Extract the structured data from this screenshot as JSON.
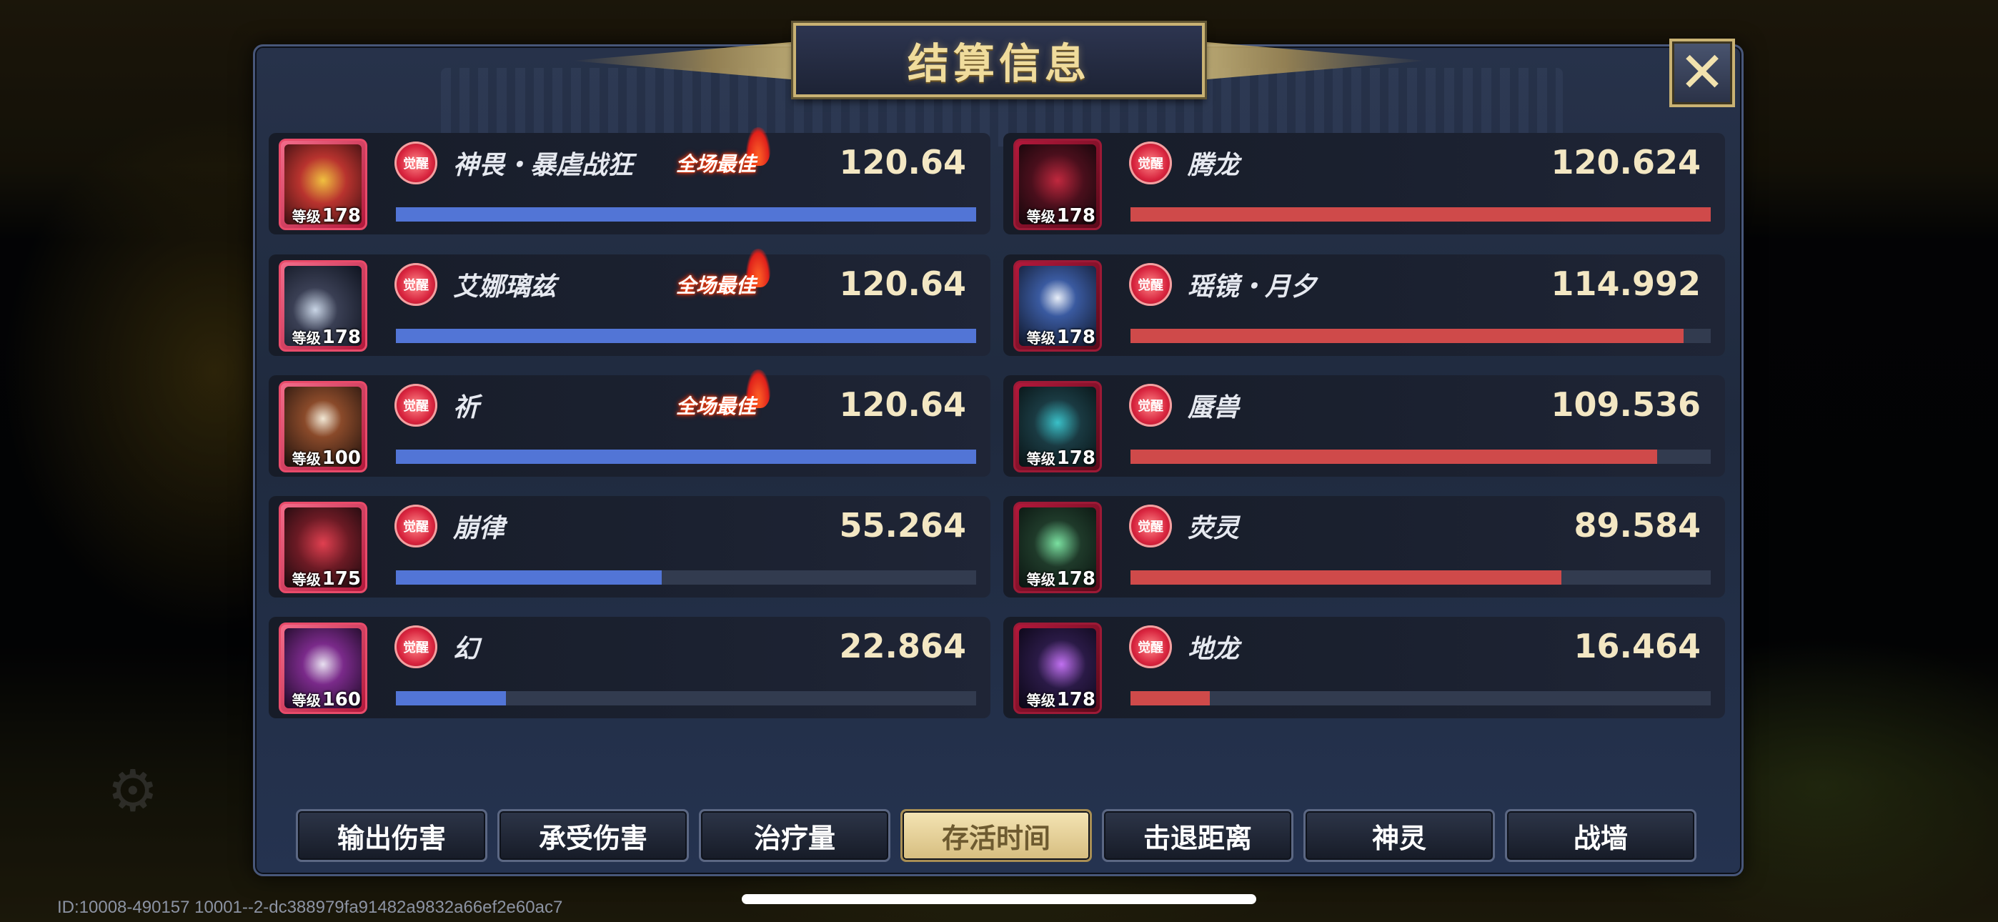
{
  "title": "结算信息",
  "mvp_label": "全场最佳",
  "level_label": "等级",
  "awake_label": "觉醒",
  "left_team": [
    {
      "name": "神畏・暴虐战狂",
      "level": "178",
      "value": "120.64",
      "mvp": true,
      "fill": 1.0,
      "avatar_color": "#b8332e"
    },
    {
      "name": "艾娜璃兹",
      "level": "178",
      "value": "120.64",
      "mvp": true,
      "fill": 1.0,
      "avatar_color": "#3a3f54"
    },
    {
      "name": "祈",
      "level": "100",
      "value": "120.64",
      "mvp": true,
      "fill": 1.0,
      "avatar_color": "#2c1f1a"
    },
    {
      "name": "崩律",
      "level": "175",
      "value": "55.264",
      "mvp": false,
      "fill": 0.458,
      "avatar_color": "#6b1a24"
    },
    {
      "name": "幻",
      "level": "160",
      "value": "22.864",
      "mvp": false,
      "fill": 0.19,
      "avatar_color": "#3c1d4a"
    }
  ],
  "right_team": [
    {
      "name": "腾龙",
      "level": "178",
      "value": "120.624",
      "fill": 1.0,
      "avatar_color": "#4a0f1c"
    },
    {
      "name": "瑶镜・月夕",
      "level": "178",
      "value": "114.992",
      "fill": 0.953,
      "avatar_color": "#1e2a4a"
    },
    {
      "name": "蜃兽",
      "level": "178",
      "value": "109.536",
      "fill": 0.908,
      "avatar_color": "#1a3a42"
    },
    {
      "name": "荧灵",
      "level": "178",
      "value": "89.584",
      "fill": 0.743,
      "avatar_color": "#1f3a2a"
    },
    {
      "name": "地龙",
      "level": "178",
      "value": "16.464",
      "fill": 0.137,
      "avatar_color": "#2a1a46"
    }
  ],
  "tabs": [
    {
      "label": "输出伤害",
      "active": false
    },
    {
      "label": "承受伤害",
      "active": false
    },
    {
      "label": "治疗量",
      "active": false
    },
    {
      "label": "存活时间",
      "active": true
    },
    {
      "label": "击退距离",
      "active": false
    },
    {
      "label": "神灵",
      "active": false
    },
    {
      "label": "战墙",
      "active": false
    }
  ],
  "id_text": "ID:10008-490157 10001--2-dc388979fa91482a9832a66ef2e60ac7",
  "close_icon": "close-icon",
  "colors": {
    "left_bar": "#5275d6",
    "right_bar": "#cf4a4a",
    "gold": "#c9b273"
  }
}
